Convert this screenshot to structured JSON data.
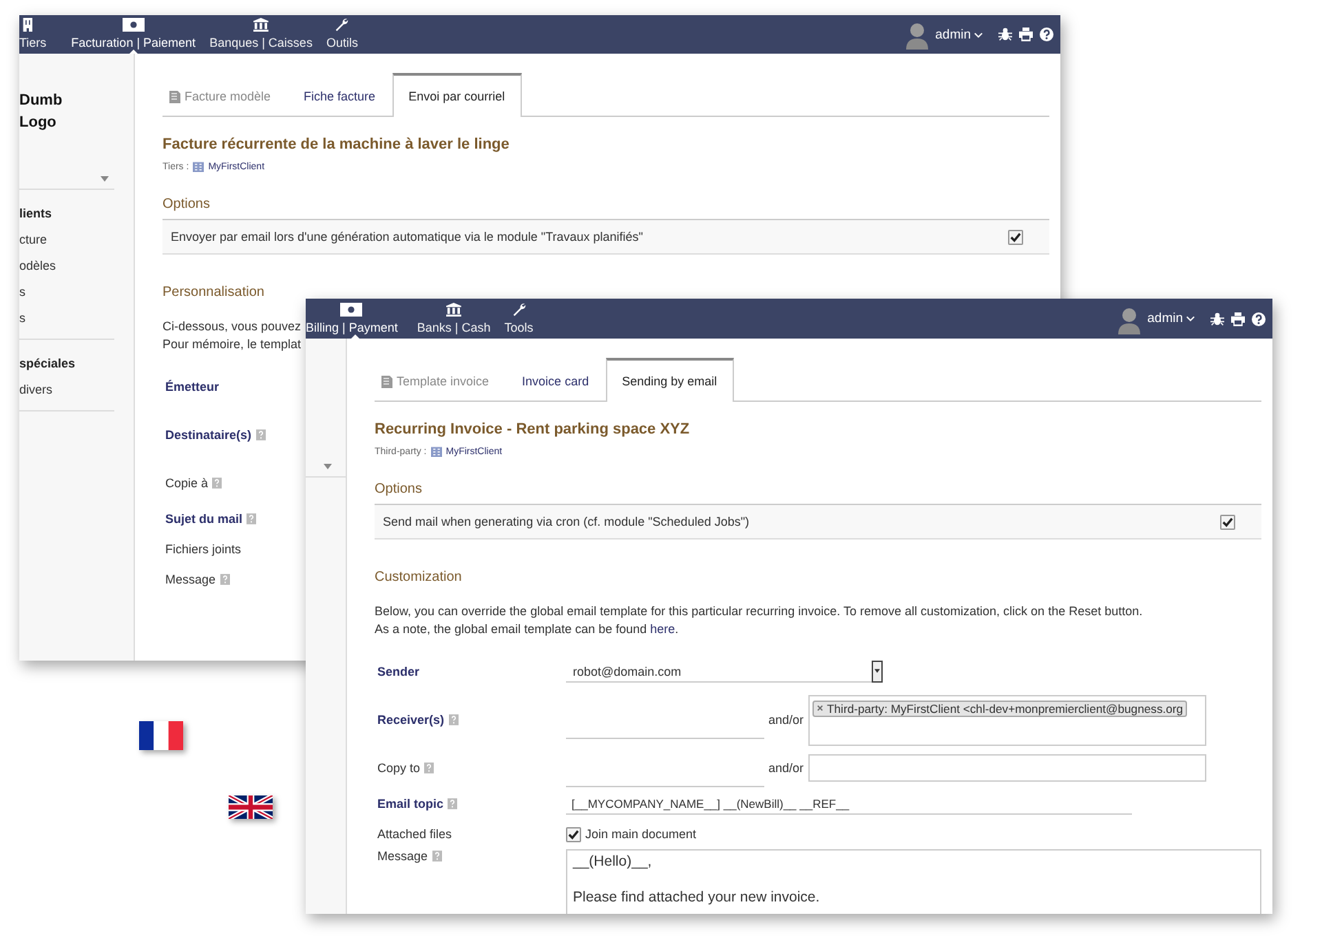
{
  "windows": [
    {
      "nav": [
        {
          "label": "Tiers",
          "kind": "building",
          "selected": false
        },
        {
          "label": "Facturation | Paiement",
          "kind": "money",
          "selected": true
        },
        {
          "label": "Banques | Caisses",
          "kind": "bank",
          "selected": false
        },
        {
          "label": "Outils",
          "kind": "wrench",
          "selected": false
        }
      ],
      "user": "admin",
      "sidebar": {
        "logo": [
          "Dumb",
          "Logo"
        ],
        "groups": [
          [
            {
              "label": "lients",
              "bold": true
            },
            {
              "label": "cture",
              "bold": false
            },
            {
              "label": "odèles",
              "bold": false
            },
            {
              "label": "s",
              "bold": false
            },
            {
              "label": "s",
              "bold": false
            }
          ],
          [
            {
              "label": "spéciales",
              "bold": true
            },
            {
              "label": "divers",
              "bold": false
            }
          ]
        ]
      },
      "tabs": [
        {
          "label": "Facture modèle",
          "kind": "icon",
          "selected": false
        },
        {
          "label": "Fiche facture",
          "kind": "link",
          "selected": false
        },
        {
          "label": "Envoi par courriel",
          "kind": "link",
          "selected": true
        }
      ],
      "title": "Facture récurrente de la machine à laver le linge",
      "party": {
        "label": "Tiers :",
        "name": "MyFirstClient"
      },
      "options": {
        "heading": "Options",
        "rows": [
          {
            "label": "Envoyer par email lors d'une génération automatique via le module \"Travaux planifiés\"",
            "checked": true
          }
        ]
      },
      "customization": {
        "heading": "Personnalisation",
        "paragraph": [
          {
            "text": "Ci-dessous, vous pouvez"
          },
          {
            "text": "Pour mémoire, le templat"
          }
        ],
        "rows": [
          {
            "label": "Émetteur",
            "required": true,
            "help": false,
            "kind": "none"
          },
          {
            "label": "Destinataire(s)",
            "required": true,
            "help": true,
            "kind": "none"
          },
          {
            "label": "Copie à",
            "required": false,
            "help": true,
            "kind": "none"
          },
          {
            "label": "Sujet du mail",
            "required": true,
            "help": true,
            "kind": "none"
          },
          {
            "label": "Fichiers joints",
            "required": false,
            "help": false,
            "kind": "none"
          },
          {
            "label": "Message",
            "required": false,
            "help": true,
            "kind": "none"
          }
        ]
      }
    },
    {
      "nav": [
        {
          "label": "Billing | Payment",
          "kind": "money",
          "selected": true
        },
        {
          "label": "Banks | Cash",
          "kind": "bank",
          "selected": false
        },
        {
          "label": "Tools",
          "kind": "wrench",
          "selected": false
        }
      ],
      "user": "admin",
      "tabs": [
        {
          "label": "Template invoice",
          "kind": "icon",
          "selected": false
        },
        {
          "label": "Invoice card",
          "kind": "link",
          "selected": false
        },
        {
          "label": "Sending by email",
          "kind": "link",
          "selected": true
        }
      ],
      "title": "Recurring Invoice - Rent parking space XYZ",
      "party": {
        "label": "Third-party :",
        "name": "MyFirstClient"
      },
      "options": {
        "heading": "Options",
        "rows": [
          {
            "label": "Send mail when generating via cron (cf. module \"Scheduled Jobs\")",
            "checked": true
          }
        ]
      },
      "customization": {
        "heading": "Customization",
        "paragraph": [
          {
            "text": "Below, you can override the global email template for this particular recurring invoice. To remove all customization, click on the Reset button."
          },
          {
            "text": "As a note, the global email template can be found ",
            "link": "here",
            "after": "."
          }
        ],
        "rows": [
          {
            "label": "Sender",
            "required": true,
            "help": false,
            "kind": "select",
            "value": "robot@domain.com"
          },
          {
            "label": "Receiver(s)",
            "required": true,
            "help": true,
            "kind": "dual",
            "joiner": "and/or",
            "tags": [
              "Third-party: MyFirstClient <chl-dev+monpremierclient@bugness.org"
            ]
          },
          {
            "label": "Copy to",
            "required": false,
            "help": true,
            "kind": "dual",
            "joiner": "and/or",
            "tags": []
          },
          {
            "label": "Email topic",
            "required": true,
            "help": true,
            "kind": "text",
            "value": "[__MYCOMPANY_NAME__] __(NewBill)__ __REF__"
          },
          {
            "label": "Attached files",
            "required": false,
            "help": false,
            "kind": "checkbox",
            "checked": true,
            "value": "Join main document"
          },
          {
            "label": "Message",
            "required": false,
            "help": true,
            "kind": "textarea",
            "lines": [
              "__(Hello)__,",
              "Please find attached your new invoice."
            ]
          }
        ]
      }
    }
  ],
  "flags": [
    {
      "kind": "fr"
    },
    {
      "kind": "uk"
    }
  ]
}
